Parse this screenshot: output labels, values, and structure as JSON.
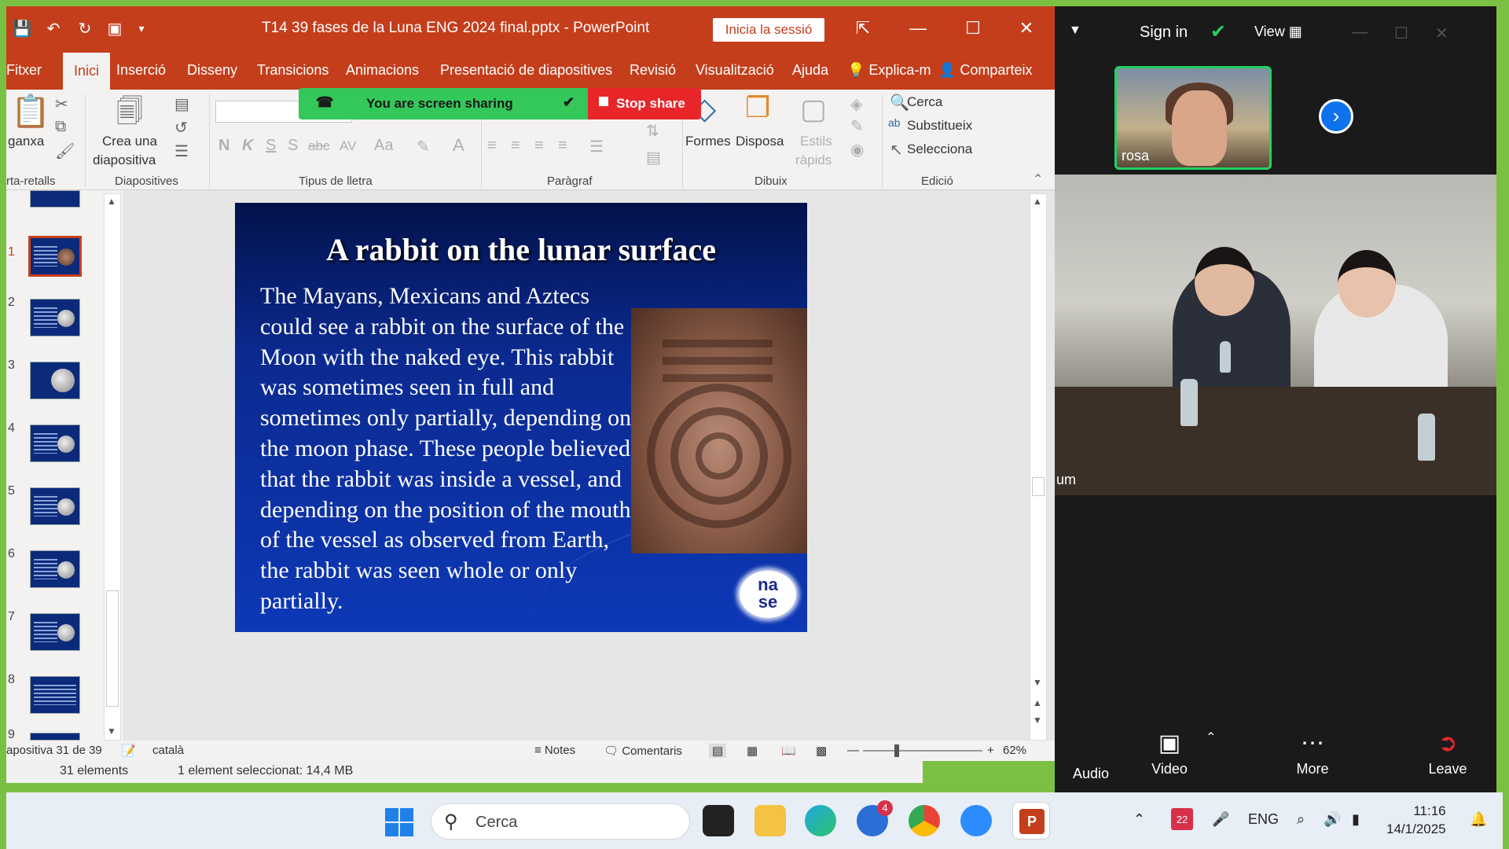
{
  "ppt": {
    "title": "T14 39 fases de la Luna  ENG 2024 final.pptx  -  PowerPoint",
    "signin_label": "Inicia la sessió",
    "tabs": [
      "Fitxer",
      "Inici",
      "Inserció",
      "Disseny",
      "Transicions",
      "Animacions",
      "Presentació de diapositives",
      "Revisió",
      "Visualització",
      "Ajuda",
      "Explica-m",
      "Comparteix"
    ],
    "ribbon": {
      "clipboard_label": "ganxa",
      "clipboard_group": "rta-retalls",
      "new_slide_line1": "Crea una",
      "new_slide_line2": "diapositiva",
      "slides_group": "Diapositives",
      "font_group": "Tipus de lletra",
      "paragraph_group": "Paràgraf",
      "shapes_label": "Formes",
      "arrange_label": "Disposa",
      "quick_styles_line1": "Estils",
      "quick_styles_line2": "ràpids",
      "drawing_group": "Dibuix",
      "find_label": "Cerca",
      "replace_label": "Substitueix",
      "select_label": "Selecciona",
      "editing_group": "Edició",
      "font_buttons": [
        "N",
        "K",
        "S",
        "S",
        "abc",
        "AV",
        "Aa"
      ]
    },
    "share_bar": {
      "label": "You are screen sharing",
      "stop_label": "Stop share"
    },
    "thumb_numbers": [
      "2",
      "3",
      "4",
      "5",
      "6",
      "7",
      "8",
      "9"
    ],
    "slide": {
      "title": "A rabbit on the lunar surface",
      "body": "The Mayans, Mexicans and Aztecs could see a rabbit on the surface of the Moon with the naked eye. This rabbit was sometimes seen in full and sometimes only partially, depending on the moon phase. These people believed that the rabbit was inside a vessel, and depending on the position of the mouth of the vessel as observed from Earth, the rabbit was seen whole or only partially.",
      "logo_line1": "na",
      "logo_line2": "se"
    },
    "status": {
      "slide_counter": "apositiva 31 de 39",
      "language": "català",
      "notes": "Notes",
      "comments": "Comentaris",
      "zoom_level": "62%"
    }
  },
  "explorer": {
    "count": "31 elements",
    "selection": "1 element seleccionat: 14,4 MB"
  },
  "zoom": {
    "signin": "Sign in",
    "view": "View",
    "participant_name": "rosa",
    "partial_name": "um",
    "controls": [
      "Audio",
      "Video",
      "More",
      "Leave"
    ],
    "accent_color": "#0e72ed",
    "active_speaker_color": "#23d160"
  },
  "taskbar": {
    "search_placeholder": "Cerca",
    "outlook_badge": "4",
    "calendar_day": "22",
    "language": "ENG",
    "time": "11:16",
    "date": "14/1/2025"
  }
}
